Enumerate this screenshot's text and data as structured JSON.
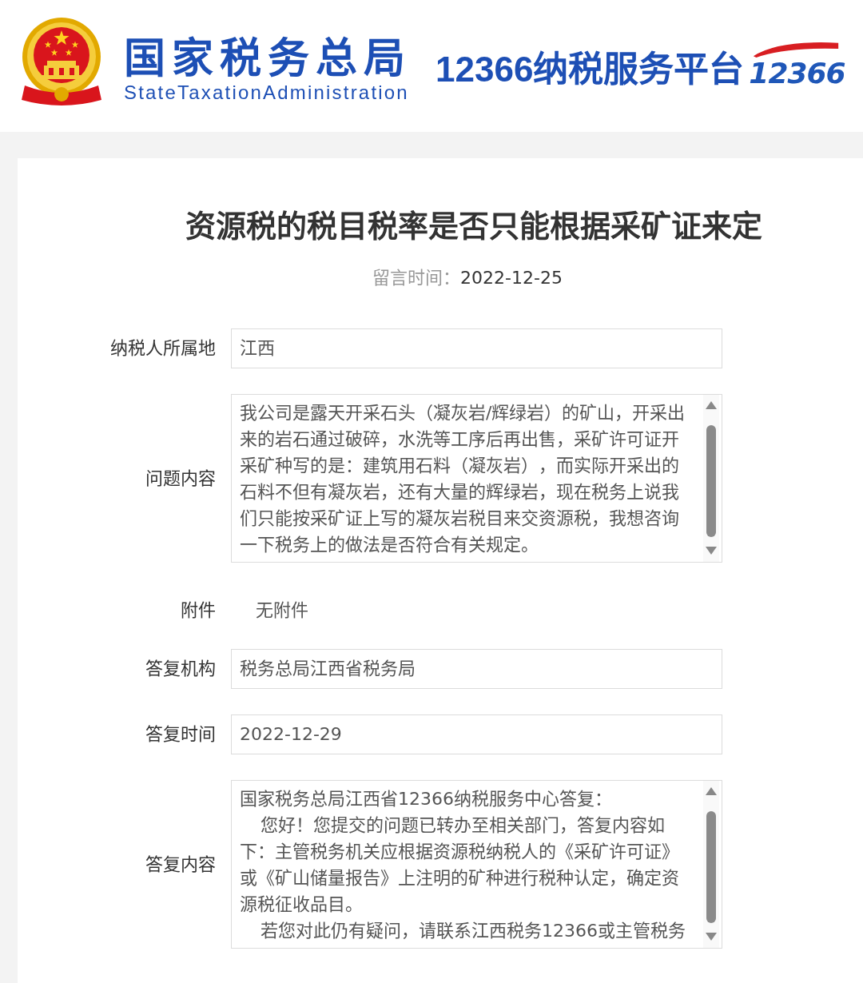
{
  "header": {
    "agency_name": "国家税务总局",
    "agency_name_en": "StateTaxationAdministration",
    "platform_name": "12366纳税服务平台",
    "hotline_logo": "12366"
  },
  "message": {
    "title": "资源税的税目税率是否只能根据采矿证来定",
    "time_label": "留言时间：",
    "time_value": "2022-12-25"
  },
  "fields": [
    {
      "kind": "input",
      "label": "纳税人所属地",
      "value": "江西"
    },
    {
      "kind": "textarea",
      "label": "问题内容",
      "paragraphs": [
        {
          "text": "我公司是露天开采石头（凝灰岩/辉绿岩）的矿山，开采出来的岩石通过破碎，水洗等工序后再出售，采矿许可证开采矿种写的是：建筑用石料（凝灰岩），而实际开采出的石料不但有凝灰岩，还有大量的辉绿岩，现在税务上说我们只能按采矿证上写的凝灰岩税目来交资源税，我想咨询一下税务上的做法是否符合有关规定。",
          "indented": false
        }
      ]
    },
    {
      "kind": "plain",
      "label": "附件",
      "value": "无附件"
    },
    {
      "kind": "input",
      "label": "答复机构",
      "value": "税务总局江西省税务局"
    },
    {
      "kind": "input",
      "label": "答复时间",
      "value": "2022-12-29"
    },
    {
      "kind": "textarea",
      "label": "答复内容",
      "paragraphs": [
        {
          "text": "国家税务总局江西省12366纳税服务中心答复：",
          "indented": false
        },
        {
          "text": "您好！您提交的问题已转办至相关部门，答复内容如下：主管税务机关应根据资源税纳税人的《采矿许可证》或《矿山储量报告》上注明的矿种进行税种认定，确定资源税征收品目。",
          "indented": true
        },
        {
          "text": "若您对此仍有疑问，请联系江西税务12366或主管税务",
          "indented": true
        }
      ]
    }
  ]
}
